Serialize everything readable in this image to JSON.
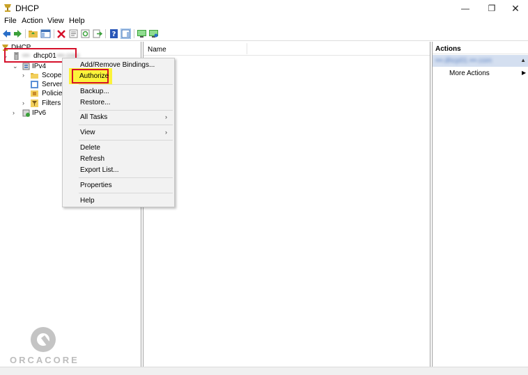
{
  "window": {
    "title": "DHCP",
    "minimize": "—",
    "maximize": "❐",
    "close": "✕"
  },
  "menu": [
    "File",
    "Action",
    "View",
    "Help"
  ],
  "tree": {
    "root": "DHCP",
    "server_prefix": "•••",
    "server": "dhcp01",
    "server_suffix": "•••.com",
    "ipv4": "IPv4",
    "children": [
      "Scope [",
      "Server C",
      "Policies",
      "Filters"
    ],
    "ipv6": "IPv6"
  },
  "results": {
    "column_name": "Name"
  },
  "actions": {
    "title": "Actions",
    "selected": "•••.dhcp01.•••.com",
    "more": "More Actions"
  },
  "context_menu": {
    "add_remove": "Add/Remove Bindings...",
    "authorize": "Authorize",
    "backup": "Backup...",
    "restore": "Restore...",
    "all_tasks": "All Tasks",
    "view": "View",
    "delete": "Delete",
    "refresh": "Refresh",
    "export": "Export List...",
    "properties": "Properties",
    "help": "Help"
  },
  "watermark": "ORCACORE"
}
